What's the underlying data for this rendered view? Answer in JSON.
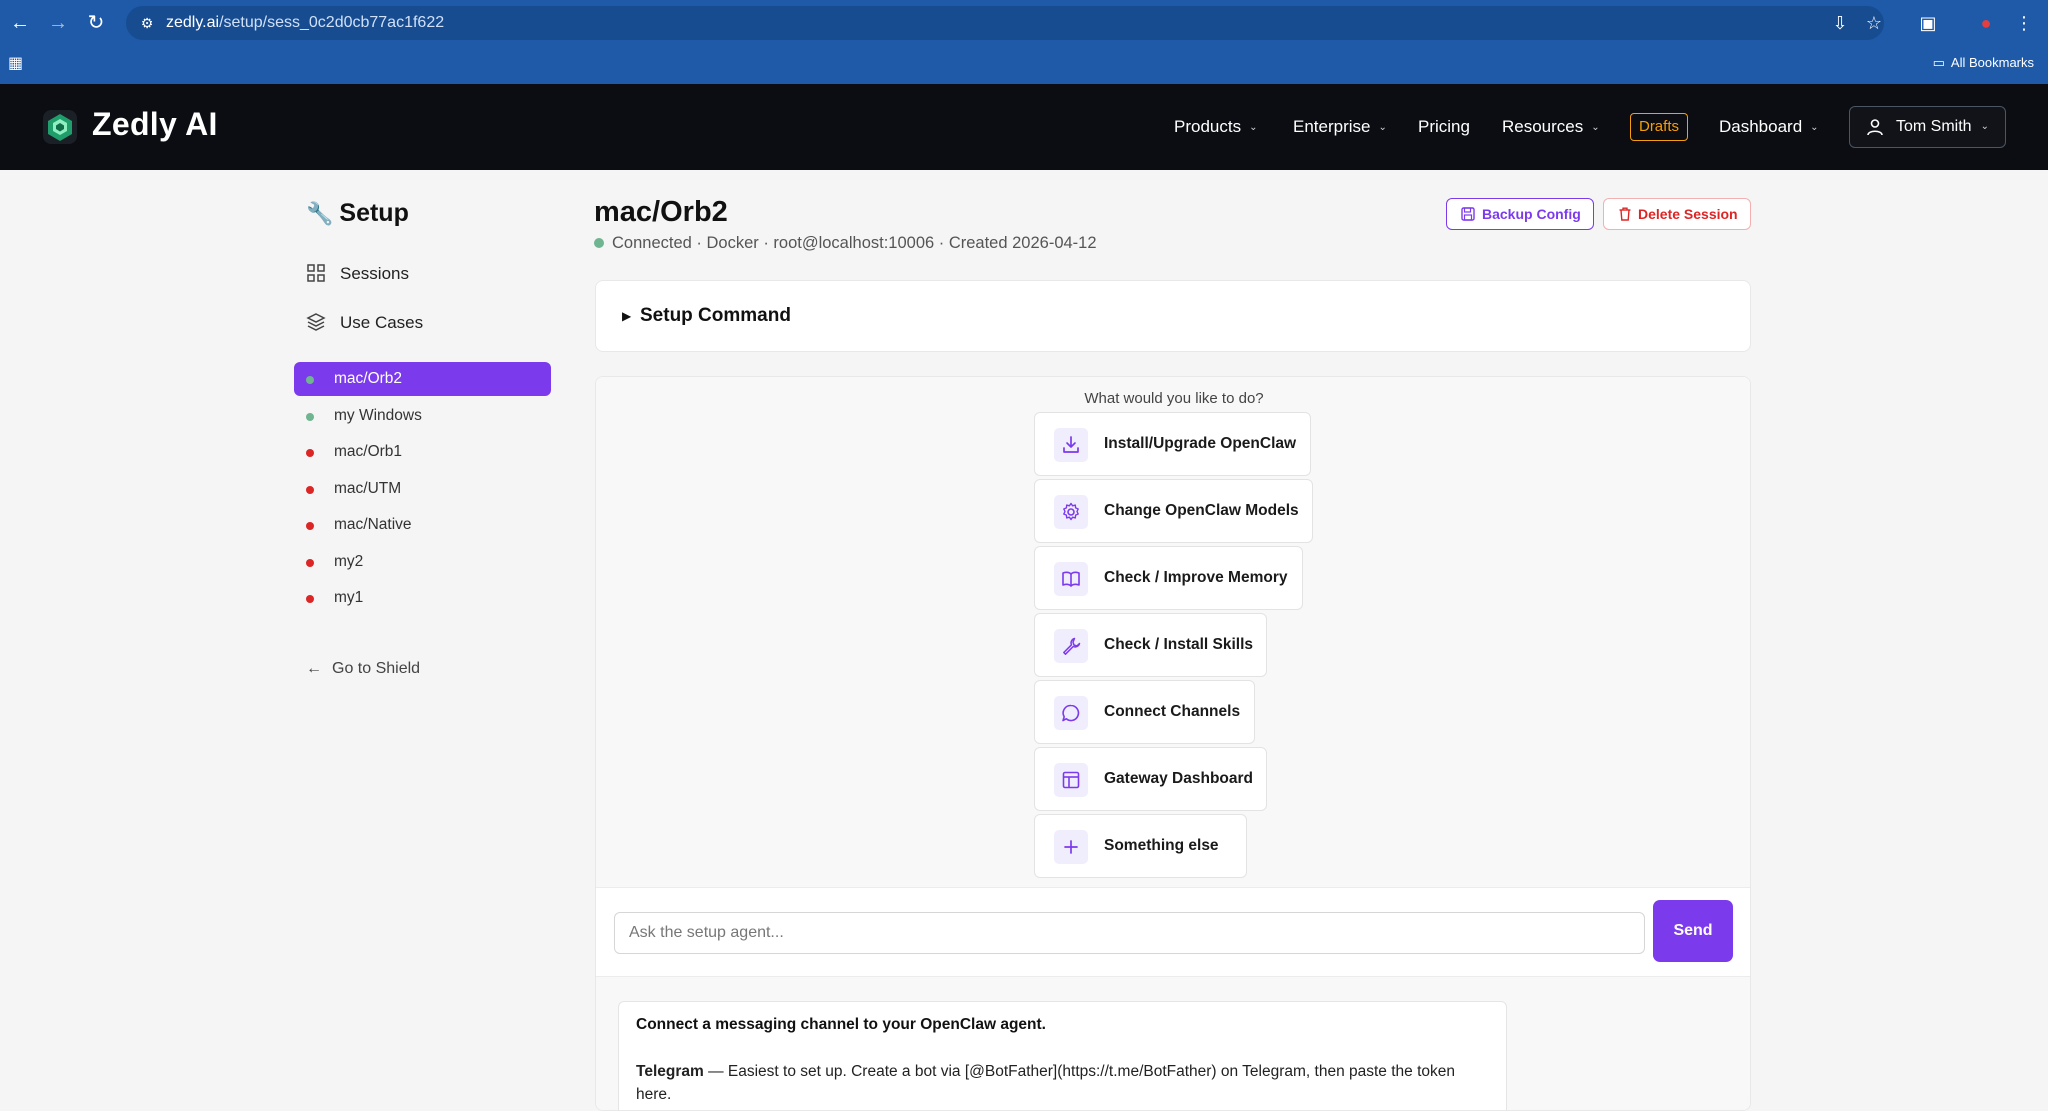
{
  "browser": {
    "url_host": "zedly.ai",
    "url_path": "/setup/sess_0c2d0cb77ac1f622",
    "bookmarks_label": "All Bookmarks"
  },
  "header": {
    "brand": "Zedly AI",
    "nav": [
      "Products",
      "Enterprise",
      "Pricing",
      "Resources",
      "Drafts",
      "Dashboard"
    ],
    "user": "Tom Smith"
  },
  "sidebar": {
    "title": "Setup",
    "links": [
      "Sessions",
      "Use Cases"
    ],
    "sessions": [
      {
        "label": "mac/Orb2",
        "status": "connected",
        "active": true
      },
      {
        "label": "my Windows",
        "status": "connected",
        "active": false
      },
      {
        "label": "mac/Orb1",
        "status": "disconnected",
        "active": false
      },
      {
        "label": "mac/UTM",
        "status": "disconnected",
        "active": false
      },
      {
        "label": "mac/Native",
        "status": "disconnected",
        "active": false
      },
      {
        "label": "my2",
        "status": "disconnected",
        "active": false
      },
      {
        "label": "my1",
        "status": "disconnected",
        "active": false
      }
    ],
    "back_link": "Go to Shield"
  },
  "main": {
    "title": "mac/Orb2",
    "status": "Connected · Docker · root@localhost:10006 · Created 2026-04-12",
    "backup_label": "Backup Config",
    "delete_label": "Delete Session",
    "setup_command_label": "Setup Command",
    "prompt": "What would you like to do?",
    "options": [
      {
        "label": "Install/Upgrade OpenClaw",
        "icon": "download-icon"
      },
      {
        "label": "Change OpenClaw Models",
        "icon": "gear-icon"
      },
      {
        "label": "Check / Improve Memory",
        "icon": "book-icon"
      },
      {
        "label": "Check / Install Skills",
        "icon": "wrench-icon"
      },
      {
        "label": "Connect Channels",
        "icon": "chat-bubble-icon"
      },
      {
        "label": "Gateway Dashboard",
        "icon": "layout-icon"
      },
      {
        "label": "Something else",
        "icon": "plus-icon"
      }
    ],
    "input_placeholder": "Ask the setup agent...",
    "send_label": "Send",
    "message": {
      "heading": "Connect a messaging channel to your OpenClaw agent.",
      "channel_name": "Telegram",
      "channel_text": " — Easiest to set up. Create a bot via [@BotFather](https://t.me/BotFather) on Telegram, then paste the token here."
    }
  },
  "colors": {
    "accent": "#7c3aed",
    "browser_bar": "#1e5aa8",
    "header_bg": "#0b0d12",
    "connected": "#6fb58f",
    "disconnected": "#dc2626",
    "drafts": "#f59e0b"
  }
}
